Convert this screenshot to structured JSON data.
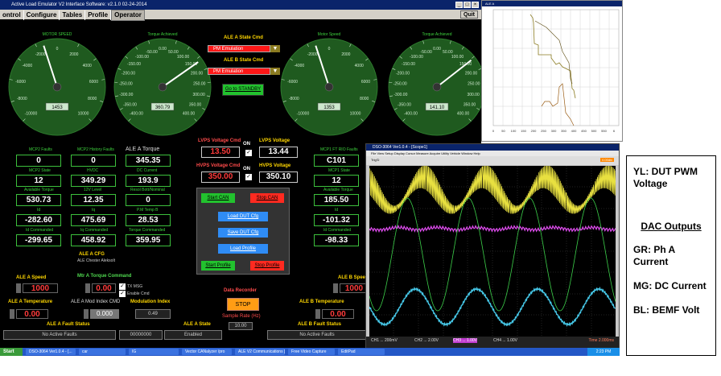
{
  "app": {
    "title": "Active Load Emulator V2 Interface Software: v2.1.0 02-24-2014",
    "menu": [
      "ontrol",
      "Configure",
      "Tables",
      "Profile",
      "Operator"
    ],
    "quit": "Quit"
  },
  "gauges": [
    {
      "label": "MOTOR SPEED",
      "value": "1453",
      "ticks": [
        "-2000",
        "2000",
        "-4000",
        "4000",
        "-6000",
        "6000",
        "-8000",
        "8000",
        "-10000",
        "10000",
        "0"
      ]
    },
    {
      "label": "Torque Achieved",
      "value": "360.79",
      "ticks": [
        "-50.00",
        "50.00",
        "-100.00",
        "100.00",
        "-150.00",
        "150.00",
        "-200.00",
        "200.00",
        "-250.00",
        "250.00",
        "-300.00",
        "300.00",
        "-350.00",
        "350.00",
        "-400.00",
        "400.00",
        "0.00"
      ]
    },
    {
      "label": "Motor Speed",
      "value": "1353",
      "ticks": [
        "-2000",
        "2000",
        "-4000",
        "4000",
        "-6000",
        "6000",
        "-8000",
        "8000",
        "-10000",
        "10000",
        "0"
      ]
    },
    {
      "label": "Torque Achieved",
      "value": "141.10",
      "ticks": [
        "-50.00",
        "50.00",
        "-100.00",
        "100.00",
        "-150.00",
        "150.00",
        "-200.00",
        "200.00",
        "-250.00",
        "250.00",
        "-300.00",
        "300.00",
        "-350.00",
        "350.00",
        "-400.00",
        "400.00",
        "0.00"
      ]
    }
  ],
  "state": {
    "a_label": "ALE A State Cmd",
    "a_value": "PM Emulation",
    "b_label": "ALE B State Cmd",
    "b_value": "PM Emulation",
    "standby": "Go to STANDBY"
  },
  "left_panel": {
    "mcp2_faults_label": "MCP2 Faults",
    "mcp2_faults": "0",
    "mcp2_hist_label": "MCP2 History Faults",
    "mcp2_hist": "0",
    "torque_label": "ALE A Torque",
    "torque": "345.35",
    "mcp2_state_label": "MCP2 State",
    "mcp2_state": "12",
    "hvdc_label": "HVDC",
    "hvdc": "349.29",
    "dc_current_label": "DC Current",
    "dc_current": "193.9",
    "avail_torque_label": "Available Torque",
    "avail_torque": "530.73",
    "v12_label": "12V Level",
    "v12": "12.35",
    "resolver_label": "Resol Bott/Nominal",
    "resolver": "0",
    "id_label": "Id",
    "id": "-282.60",
    "iq_label": "Iq",
    "iq": "475.69",
    "pm_temp_label": "P.M Temp B",
    "pm_temp": "28.53",
    "id_cmd_label": "Id Commanded",
    "id_cmd": "-299.65",
    "iq_cmd_label": "Iq Commanded",
    "iq_cmd": "458.92",
    "torque_cmd_label": "Torque Commanded",
    "torque_cmd": "359.95",
    "cfg_label": "ALE A CFG",
    "cfg_sub": "ALE Chester Aleksolt"
  },
  "voltage": {
    "lvps_cmd_label": "LVPS Voltage Cmd",
    "lvps_cmd": "13.50",
    "lvps_label": "LVPS Voltage",
    "lvps": "13.44",
    "hvps_cmd_label": "HVPS Voltage Cmd",
    "hvps_cmd": "350.00",
    "hvps_label": "HVPS Voltage",
    "hvps": "350.10",
    "on": "ON"
  },
  "buttons": {
    "start_can": "Start CAN",
    "stop_can": "Stop CAN",
    "load_dut": "Load DUT Cfg",
    "save_dut": "Save DUT Cfg",
    "load_profile": "Load Profile",
    "start_profile": "Start Profile",
    "stop_profile": "Stop Profile"
  },
  "right_panel": {
    "faults_label": "MCP1 FT RIO Faults",
    "faults": "C101",
    "state_label": "MCP1 State",
    "state": "12",
    "avail_torque_label": "Available Torque",
    "avail_torque": "185.50",
    "id_label": "Id",
    "id": "-101.32",
    "id_cmd_label": "Id Commanded",
    "id_cmd": "-98.33"
  },
  "bottom": {
    "a_speed_label": "ALE A Speed",
    "a_speed": "1000",
    "mtr_torque_label": "Mtr A Torque Command",
    "mtr_torque": "0.00",
    "tx_msg": "TX MSG",
    "enable_cmd": "Enable Cmd",
    "a_temp_label": "ALE A Temperature",
    "a_temp": "0.00",
    "mod_index_cmd_label": "ALE A Mod Index CMD",
    "mod_index_cmd": "0.000",
    "mod_index_label": "Modulation Index",
    "mod_index": "0.49",
    "b_speed_label": "ALE B Speed",
    "b_speed": "1000",
    "b_temp_label": "ALE B Temperature",
    "b_temp": "0.00",
    "recorder_label": "Data Recorder",
    "stop": "STOP",
    "rate_label": "Sample Rate (Hz)",
    "rate": "10.00",
    "a_fault_label": "ALE A Fault Status",
    "a_fault": "No Active Faults",
    "a_state_label": "ALE A State",
    "a_state_code": "00000000",
    "a_state": "Enabled",
    "b_fault_label": "ALE B Fault Status",
    "b_fault": "No Active Faults"
  },
  "scope": {
    "title": "DSO-3064 Ver1.0.4 - [Scope1]",
    "menu": "File  View  Setup  Display  Cursor  Measure  Acquire  Utility  Vehicle  Window  Help",
    "ch1": "CH1 ... 200mV",
    "ch2": "CH2 ... 2.00V",
    "ch3": "CH3 ... 1.00V",
    "ch4": "CH4 ... 1.00V",
    "time": "Time 2.000ms",
    "trig": "Trig'D",
    "offset": "0.00div"
  },
  "graph": {
    "xticks": [
      "0",
      "50",
      "100",
      "150",
      "200",
      "250",
      "300",
      "350",
      "400",
      "450",
      "500",
      "550",
      "6"
    ],
    "title": "ALE A"
  },
  "taskbar": {
    "start": "Start",
    "items": [
      "DSO-3064 Ver1.0.4 - [...",
      "car",
      "IG",
      "Vector CANalyzer /pro",
      "ALE V2 Communications [...",
      "Free Video Capture",
      "EditPad"
    ],
    "clock": "2:23 PM"
  },
  "legend": {
    "yl": "YL: DUT PWM Voltage",
    "title": "DAC Outputs",
    "gr": "GR: Ph A Current",
    "mg": "MG: DC Current",
    "bl": "BL: BEMF Volt"
  },
  "colors": {
    "accent_green": "#3cc03c",
    "value_red": "#ff3b3b",
    "label_yellow": "#ffd700"
  }
}
